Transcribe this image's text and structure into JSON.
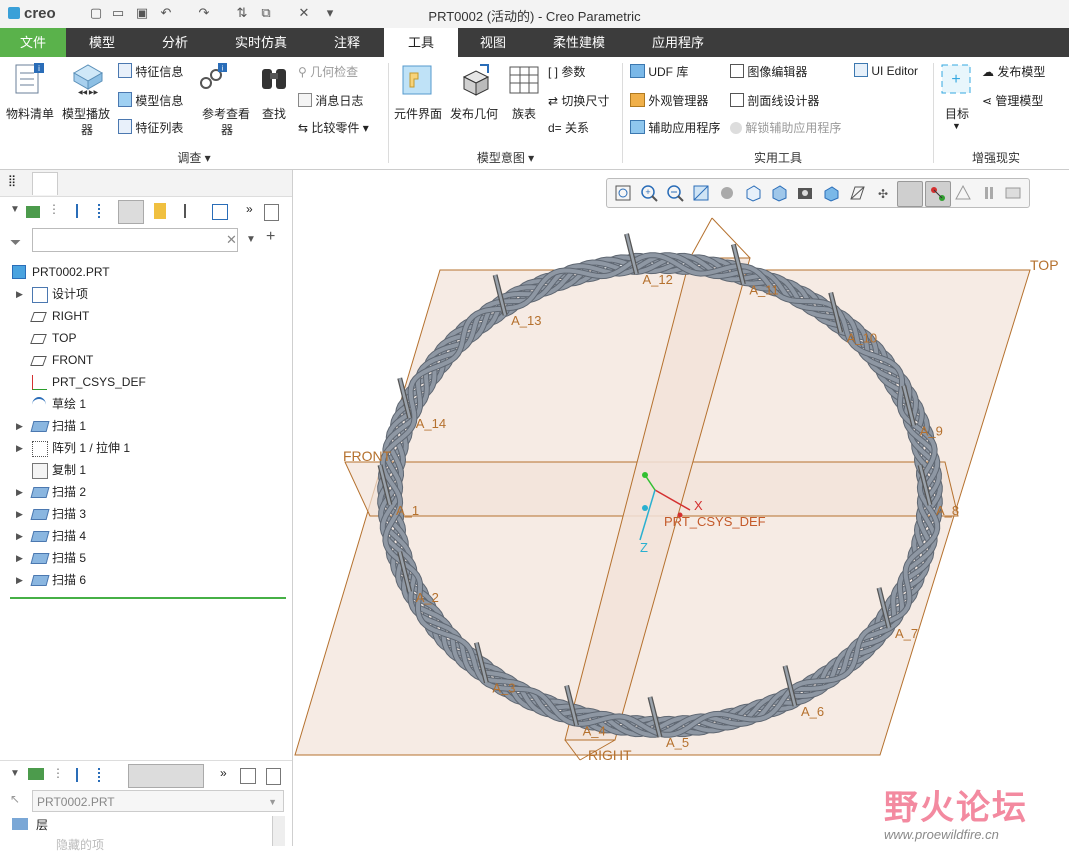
{
  "app": {
    "logo_text": "creo",
    "window_title": "PRT0002 (活动的) - Creo Parametric"
  },
  "tabs": [
    {
      "label": "文件"
    },
    {
      "label": "模型"
    },
    {
      "label": "分析"
    },
    {
      "label": "实时仿真"
    },
    {
      "label": "注释"
    },
    {
      "label": "工具"
    },
    {
      "label": "视图"
    },
    {
      "label": "柔性建模"
    },
    {
      "label": "应用程序"
    }
  ],
  "active_tab": "工具",
  "ribbon": {
    "investigate": {
      "group_label": "调查",
      "bom": "物料清单",
      "model_player_1": "模型播放",
      "model_player_2": "器",
      "feature_info": "特征信息",
      "model_info": "模型信息",
      "feature_list": "特征列表",
      "ref_viewer_1": "参考查看",
      "ref_viewer_2": "器",
      "find": "查找",
      "geometry_check": "几何检查",
      "message_log": "消息日志",
      "compare_part": "比较零件"
    },
    "model_intent": {
      "group_label": "模型意图",
      "component_interface": "元件界面",
      "publish_geometry": "发布几何",
      "family_table": "族表",
      "parameters": "参数",
      "switch_dimensions": "切换尺寸",
      "relations": "关系"
    },
    "utilities": {
      "group_label": "实用工具",
      "udf_library": "UDF 库",
      "appearance_manager": "外观管理器",
      "aux_applications": "辅助应用程序",
      "image_editor": "图像编辑器",
      "section_designer": "剖面线设计器",
      "unlock_aux_apps": "解锁辅助应用程序",
      "ui_editor": "UI Editor"
    },
    "augmented_reality": {
      "group_label": "增强现实",
      "target": "目标",
      "publish_model": "发布模型",
      "manage_model": "管理模型"
    }
  },
  "model_tree": {
    "search_placeholder": "",
    "root": "PRT0002.PRT",
    "items": [
      {
        "label": "设计项",
        "expandable": true,
        "icon": "design-items-icon"
      },
      {
        "label": "RIGHT",
        "expandable": false,
        "icon": "datum-plane-icon"
      },
      {
        "label": "TOP",
        "expandable": false,
        "icon": "datum-plane-icon"
      },
      {
        "label": "FRONT",
        "expandable": false,
        "icon": "datum-plane-icon"
      },
      {
        "label": "PRT_CSYS_DEF",
        "expandable": false,
        "icon": "csys-icon"
      },
      {
        "label": "草绘 1",
        "expandable": false,
        "icon": "sketch-icon"
      },
      {
        "label": "扫描 1",
        "expandable": true,
        "icon": "sweep-icon"
      },
      {
        "label": "阵列 1 / 拉伸 1",
        "expandable": true,
        "icon": "pattern-icon"
      },
      {
        "label": "复制 1",
        "expandable": false,
        "icon": "copy-icon"
      },
      {
        "label": "扫描 2",
        "expandable": true,
        "icon": "sweep-icon"
      },
      {
        "label": "扫描 3",
        "expandable": true,
        "icon": "sweep-icon"
      },
      {
        "label": "扫描 4",
        "expandable": true,
        "icon": "sweep-icon"
      },
      {
        "label": "扫描 5",
        "expandable": true,
        "icon": "sweep-icon"
      },
      {
        "label": "扫描 6",
        "expandable": true,
        "icon": "sweep-icon"
      }
    ]
  },
  "layer_tree": {
    "model_select": "PRT0002.PRT",
    "header": "层",
    "item": "隐藏的项"
  },
  "graphics": {
    "plane_labels": {
      "top": "TOP",
      "front": "FRONT",
      "right": "RIGHT"
    },
    "csys_label": "PRT_CSYS_DEF",
    "axis_x": "X",
    "axis_z": "Z",
    "axis_labels": [
      "A_1",
      "A_2",
      "A_3",
      "A_4",
      "A_5",
      "A_6",
      "A_7",
      "A_8",
      "A_9",
      "A_10",
      "A_11",
      "A_12",
      "A_13",
      "A_14"
    ],
    "colors": {
      "plane_fill": "#f2e3d9",
      "plane_edge": "#b5712e",
      "wire": "#8e97a3",
      "datum_text": "#b5712e",
      "csys": "#d43030"
    }
  },
  "watermark": {
    "title": "野火论坛",
    "url": "www.proewildfire.cn"
  }
}
